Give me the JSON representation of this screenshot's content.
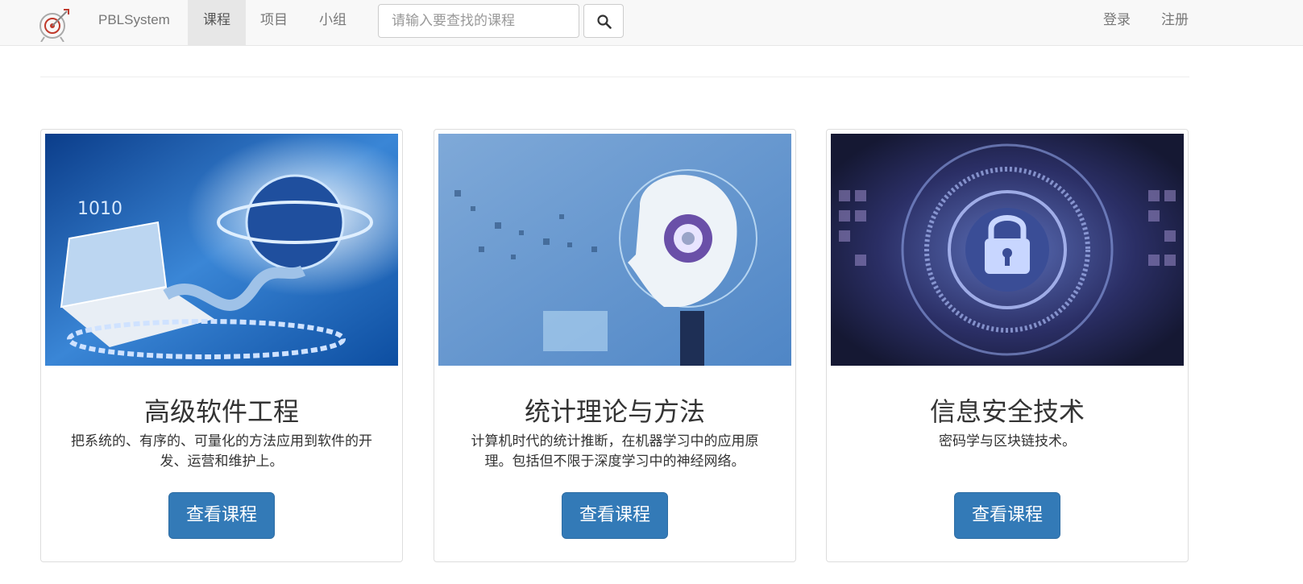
{
  "navbar": {
    "brand": "PBLSystem",
    "nav_items": [
      "课程",
      "项目",
      "小组"
    ],
    "active_item": "课程",
    "search_placeholder": "请输入要查找的课程",
    "right_items": [
      "登录",
      "注册"
    ]
  },
  "cards": [
    {
      "title": "高级软件工程",
      "description": "把系统的、有序的、可量化的方法应用到软件的开发、运营和维护上。",
      "button": "查看课程",
      "image": "laptop-globe-digital-image"
    },
    {
      "title": "统计理论与方法",
      "description": "计算机时代的统计推断，在机器学习中的应用原理。包括但不限于深度学习中的神经网络。",
      "button": "查看课程",
      "image": "robot-head-ai-image"
    },
    {
      "title": "信息安全技术",
      "description": "密码学与区块链技术。",
      "button": "查看课程",
      "image": "security-lock-image"
    }
  ],
  "colors": {
    "primary": "#337ab7",
    "navbar_bg": "#f8f8f8",
    "active_bg": "#e7e7e7"
  }
}
